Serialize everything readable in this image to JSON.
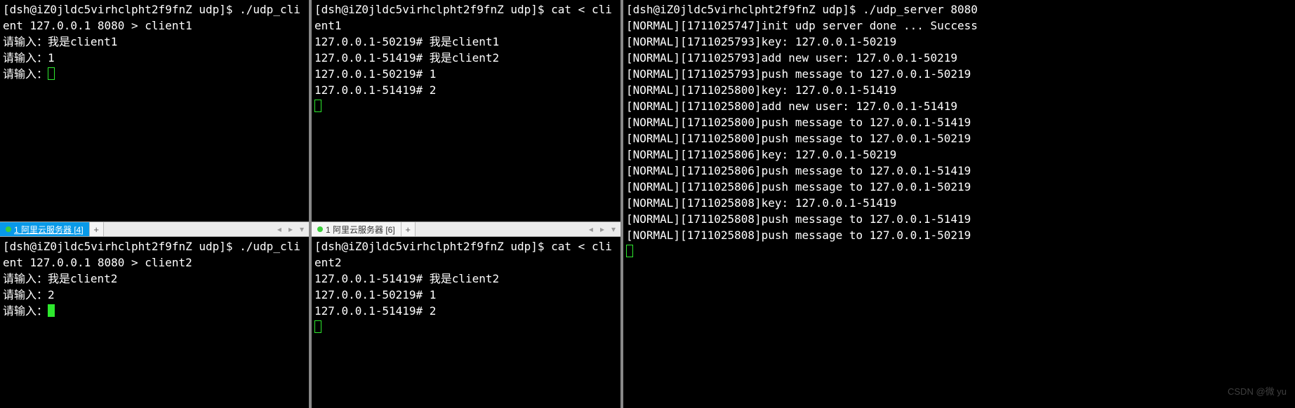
{
  "prompt": "[dsh@iZ0jldc5virhclpht2f9fnZ udp]$ ",
  "input_label": "请输入：",
  "tabs": {
    "left": {
      "label": "1 阿里云服务器 [4]"
    },
    "right": {
      "label": "1 阿里云服务器 [6]"
    }
  },
  "watermark": "CSDN @微 yu",
  "pane_tl": {
    "cmd": "./udp_client 127.0.0.1 8080 > client1",
    "inputs": [
      "我是client1",
      "1"
    ]
  },
  "pane_bl": {
    "cmd": "./udp_client 127.0.0.1 8080 > client2",
    "inputs": [
      "我是client2",
      "2"
    ]
  },
  "pane_tm": {
    "cmd": "cat < client1",
    "lines": [
      "127.0.0.1-50219# 我是client1",
      "127.0.0.1-51419# 我是client2",
      "127.0.0.1-50219# 1",
      "127.0.0.1-51419# 2"
    ]
  },
  "pane_bm": {
    "cmd": "cat < client2",
    "lines": [
      "127.0.0.1-51419# 我是client2",
      "127.0.0.1-50219# 1",
      "127.0.0.1-51419# 2"
    ]
  },
  "pane_r": {
    "cmd": "./udp_server 8080",
    "lines": [
      "[NORMAL][1711025747]init udp server done ... Success",
      "[NORMAL][1711025793]key: 127.0.0.1-50219",
      "[NORMAL][1711025793]add new user: 127.0.0.1-50219",
      "[NORMAL][1711025793]push message to 127.0.0.1-50219",
      "[NORMAL][1711025800]key: 127.0.0.1-51419",
      "[NORMAL][1711025800]add new user: 127.0.0.1-51419",
      "[NORMAL][1711025800]push message to 127.0.0.1-51419",
      "[NORMAL][1711025800]push message to 127.0.0.1-50219",
      "[NORMAL][1711025806]key: 127.0.0.1-50219",
      "[NORMAL][1711025806]push message to 127.0.0.1-51419",
      "[NORMAL][1711025806]push message to 127.0.0.1-50219",
      "[NORMAL][1711025808]key: 127.0.0.1-51419",
      "[NORMAL][1711025808]push message to 127.0.0.1-51419",
      "[NORMAL][1711025808]push message to 127.0.0.1-50219"
    ]
  },
  "layout": {
    "col1_w": 440,
    "col2_w": 440,
    "tabbar_h": 22,
    "top_h": 316
  }
}
